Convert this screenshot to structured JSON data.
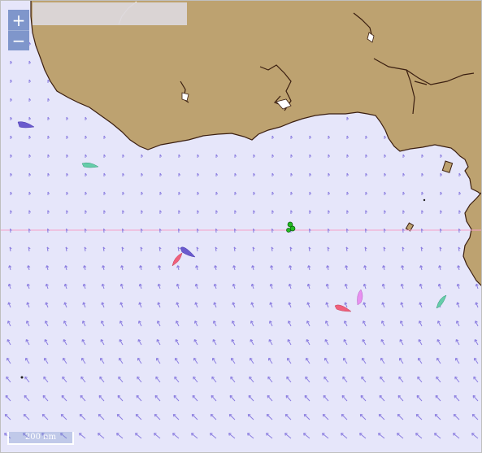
{
  "map": {
    "controls": {
      "zoom_in": "+",
      "zoom_out": "−"
    },
    "scale_bar": "200 nm",
    "colors": {
      "sea": "#e6e6fa",
      "land": "#bda270",
      "coastline": "#3a1e10",
      "equator": "#f5a0c8",
      "wind_arrow": "#8a7ce0"
    },
    "boats": [
      {
        "color": "#6a5acd"
      },
      {
        "color": "#66cdaa"
      },
      {
        "color": "#6a5acd"
      },
      {
        "color": "#f0607c"
      },
      {
        "color": "#f0607c"
      },
      {
        "color": "#e890f0"
      },
      {
        "color": "#66cdaa"
      },
      {
        "color": "#22bb22"
      }
    ]
  }
}
